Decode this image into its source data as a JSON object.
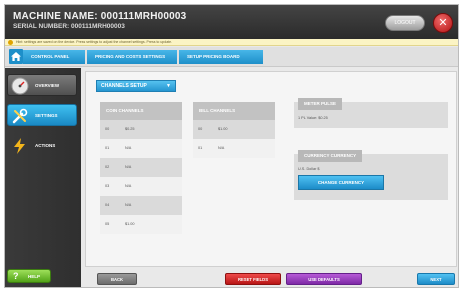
{
  "header": {
    "machine_name": "MACHINE NAME: 000111MRH00003",
    "serial_number": "SERIAL NUMBER: 000111MRH00003",
    "pill_label": "LOGOUT",
    "close_symbol": "✕"
  },
  "info_bar": {
    "text": "Hint: settings are saved on the device. Press settings to adjust the channel settings. Press to update."
  },
  "breadcrumb": {
    "items": [
      "CONTROL PANEL",
      "PRICING AND COSTS SETTINGS",
      "SETUP PRICING BOARD"
    ]
  },
  "sidebar": {
    "items": [
      {
        "label": "OVERVIEW",
        "icon": "gauge-icon"
      },
      {
        "label": "SETTINGS",
        "icon": "tools-icon"
      },
      {
        "label": "ACTIONS",
        "icon": "lightning-icon"
      }
    ],
    "active_index": 1,
    "help_label": "HELP"
  },
  "main": {
    "dropdown_label": "CHANNELS SETUP",
    "coin_channels": {
      "title": "COIN CHANNELS",
      "rows": [
        {
          "num": "00",
          "value": "$0.25"
        },
        {
          "num": "01",
          "value": "N/A"
        },
        {
          "num": "02",
          "value": "N/A"
        },
        {
          "num": "03",
          "value": "N/A"
        },
        {
          "num": "04",
          "value": "N/A"
        },
        {
          "num": "05",
          "value": "$1.00"
        }
      ]
    },
    "bill_channels": {
      "title": "BILL CHANNELS",
      "rows": [
        {
          "num": "00",
          "value": "$1.00"
        },
        {
          "num": "01",
          "value": "N/A"
        }
      ]
    },
    "meter_pulse": {
      "title": "METER PULSE",
      "text": "1 PL Value: $0.25"
    },
    "currency": {
      "title": "CURRENCY CURRENCY",
      "text": "U.S. Dollar $",
      "button_label": "CHANGE CURRENCY"
    }
  },
  "footer": {
    "back": "BACK",
    "reset": "RESET FIELDS",
    "defaults": "USE DEFAULTS",
    "next": "NEXT"
  },
  "colors": {
    "accent_blue": "#1d8fc9",
    "danger_red": "#b81616",
    "purple": "#7e2aa6",
    "help_green": "#52a318"
  }
}
